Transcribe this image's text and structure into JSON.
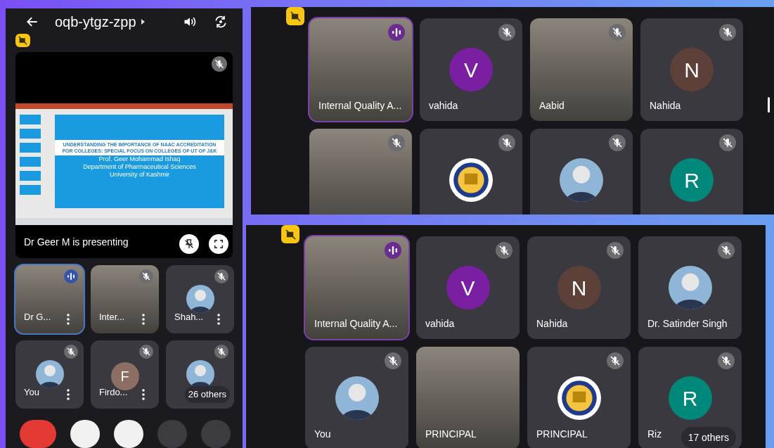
{
  "phone": {
    "meeting_code": "oqb-ytgz-zpp",
    "presentation": {
      "slide_title": "UNDERSTANDING THE IMPORTANCE OF NAAC ACCREDITATION FOR COLLEGES: SPECIAL FOCUS ON COLLEGES OF UT OF J&K",
      "slide_lines": [
        "Prof. Geer Mohammad Ishaq",
        "Department of Pharmaceutical Sciences",
        "University of Kashmir"
      ],
      "caption": "Dr Geer M is presenting",
      "muted": true
    },
    "tiles": [
      {
        "kind": "video",
        "name": "Dr G...",
        "muted": false,
        "speaking": true
      },
      {
        "kind": "video",
        "name": "Inter...",
        "muted": true,
        "speaking": false
      },
      {
        "kind": "photo",
        "name": "Shah...",
        "muted": true,
        "speaking": false
      },
      {
        "kind": "photo",
        "name": "You",
        "muted": true,
        "speaking": false
      },
      {
        "kind": "letter",
        "letter": "F",
        "color": "#8d6e63",
        "name": "Firdo...",
        "muted": true,
        "speaking": false
      },
      {
        "kind": "photo",
        "muted": true,
        "speaking": false
      }
    ],
    "others_badge": "26 others"
  },
  "grid_top": {
    "tiles": [
      {
        "kind": "video",
        "name": "Internal Quality A...",
        "muted": false,
        "speaking": true
      },
      {
        "kind": "letter",
        "letter": "V",
        "color": "#7b1fa2",
        "name": "vahida",
        "muted": true,
        "speaking": false
      },
      {
        "kind": "video",
        "name": "Aabid",
        "muted": true,
        "speaking": false
      },
      {
        "kind": "letter",
        "letter": "N",
        "color": "#5d4037",
        "name": "Nahida",
        "muted": true,
        "speaking": false
      },
      {
        "kind": "video",
        "muted": true,
        "speaking": false
      },
      {
        "kind": "logo",
        "muted": true,
        "speaking": false
      },
      {
        "kind": "photo",
        "muted": true,
        "speaking": false
      },
      {
        "kind": "letter",
        "letter": "R",
        "color": "#00897b",
        "muted": true,
        "speaking": false
      }
    ]
  },
  "grid_bottom": {
    "tiles": [
      {
        "kind": "video",
        "name": "Internal Quality A...",
        "muted": false,
        "speaking": true
      },
      {
        "kind": "letter",
        "letter": "V",
        "color": "#7b1fa2",
        "name": "vahida",
        "muted": true,
        "speaking": false
      },
      {
        "kind": "letter",
        "letter": "N",
        "color": "#5d4037",
        "name": "Nahida",
        "muted": true,
        "speaking": false
      },
      {
        "kind": "photo",
        "name": "Dr. Satinder Singh",
        "muted": true,
        "speaking": false
      },
      {
        "kind": "photo",
        "name": "You",
        "muted": true,
        "speaking": false
      },
      {
        "kind": "video",
        "name": "PRINCIPAL",
        "muted": false,
        "speaking": false
      },
      {
        "kind": "logo",
        "name": "PRINCIPAL",
        "muted": true,
        "speaking": false
      },
      {
        "kind": "letter",
        "letter": "R",
        "color": "#00897b",
        "name": "Riz",
        "muted": true,
        "speaking": false
      }
    ],
    "others_badge": "17 others"
  }
}
